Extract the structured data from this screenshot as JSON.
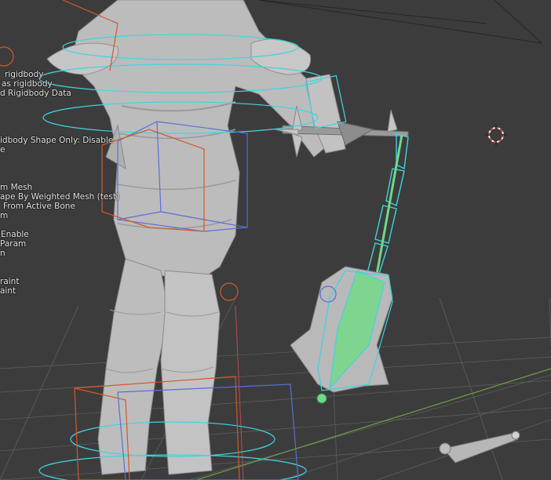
{
  "viewport": {
    "background": "#3c3c3c",
    "colors": {
      "mesh": "#bdbdbd",
      "mesh_shadow": "#8c8c8c",
      "rigidbody_cyan": "#3fd4e0",
      "constraint_blue": "#5a6ed6",
      "constraint_orange": "#d2592a",
      "bone_green": "#6fd88a",
      "grid": "#5c5c5c",
      "x_axis": "#c64c4c",
      "y_axis": "#6ea04b"
    }
  },
  "menu": {
    "items": [
      "rigidbody",
      "as rigidbody",
      "d Rigidbody Data",
      "idbody Shape Only: Disable",
      "e",
      "m Mesh",
      "ape By Weighted Mesh (test)",
      "From Active Bone",
      "m",
      "Enable",
      "Param",
      "n",
      "raint",
      "aint"
    ]
  },
  "scene_objects": [
    "character-mesh",
    "flail-chain",
    "flail-head",
    "rigidbody-capsules",
    "constraint-boxes",
    "3d-cursor",
    "floor-grid",
    "small-bone"
  ]
}
